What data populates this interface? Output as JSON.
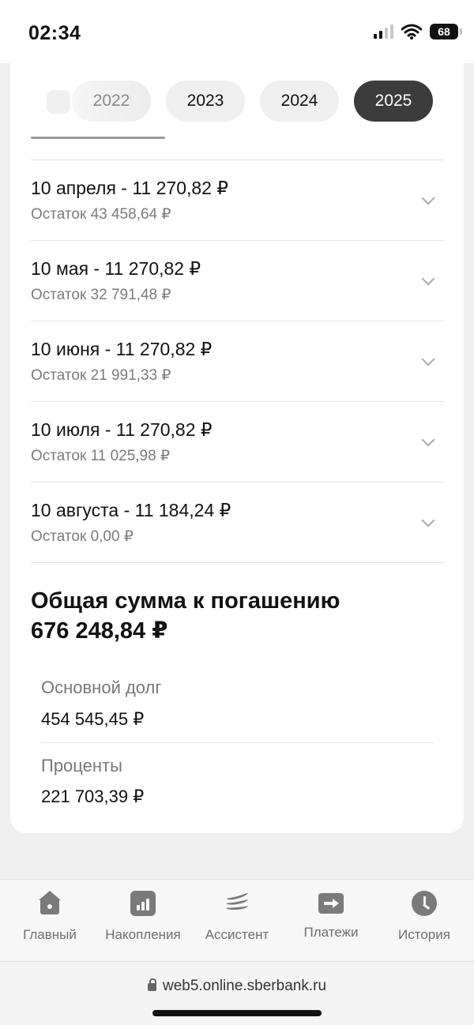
{
  "status_bar": {
    "time": "02:34",
    "battery": "68"
  },
  "years": [
    {
      "label": "2022",
      "state": "faded"
    },
    {
      "label": "2023",
      "state": "normal"
    },
    {
      "label": "2024",
      "state": "normal"
    },
    {
      "label": "2025",
      "state": "active"
    }
  ],
  "payments": [
    {
      "title": "10 апреля - 11 270,82 ₽",
      "balance": "Остаток 43 458,64 ₽"
    },
    {
      "title": "10 мая - 11 270,82 ₽",
      "balance": "Остаток 32 791,48 ₽"
    },
    {
      "title": "10 июня - 11 270,82 ₽",
      "balance": "Остаток 21 991,33 ₽"
    },
    {
      "title": "10 июля - 11 270,82 ₽",
      "balance": "Остаток 11 025,98 ₽"
    },
    {
      "title": "10 августа - 11 184,24 ₽",
      "balance": "Остаток 0,00 ₽"
    }
  ],
  "total": {
    "title": "Общая сумма к погашению",
    "amount": "676 248,84 ₽",
    "principal_label": "Основной долг",
    "principal_value": "454 545,45 ₽",
    "interest_label": "Проценты",
    "interest_value": "221 703,39 ₽"
  },
  "tabs": [
    {
      "label": "Главный",
      "icon": "home-icon"
    },
    {
      "label": "Накопления",
      "icon": "bar-chart-icon"
    },
    {
      "label": "Ассистент",
      "icon": "assistant-icon"
    },
    {
      "label": "Платежи",
      "icon": "transfer-arrow-icon"
    },
    {
      "label": "История",
      "icon": "clock-icon"
    }
  ],
  "browser": {
    "url": "web5.online.sberbank.ru"
  },
  "colors": {
    "active_pill": "#3c3c3c",
    "background": "#efefef",
    "muted_text": "#7b7b7b"
  }
}
